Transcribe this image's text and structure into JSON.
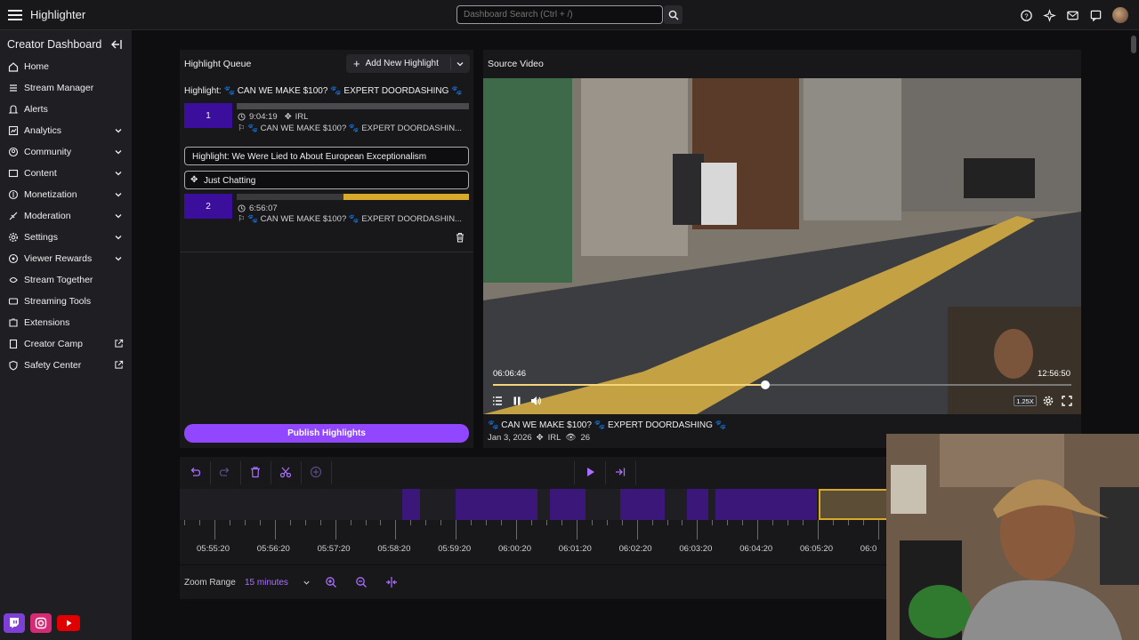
{
  "app": {
    "title": "Highlighter"
  },
  "search": {
    "placeholder": "Dashboard Search (Ctrl + /)"
  },
  "sidebar": {
    "title": "Creator Dashboard",
    "items": [
      {
        "label": "Home",
        "icon": "home-icon"
      },
      {
        "label": "Stream Manager",
        "icon": "stream-manager-icon"
      },
      {
        "label": "Alerts",
        "icon": "bell-icon"
      },
      {
        "label": "Analytics",
        "icon": "analytics-icon",
        "expandable": true
      },
      {
        "label": "Community",
        "icon": "community-icon",
        "expandable": true
      },
      {
        "label": "Content",
        "icon": "content-icon",
        "expandable": true
      },
      {
        "label": "Monetization",
        "icon": "monetization-icon",
        "expandable": true
      },
      {
        "label": "Moderation",
        "icon": "sword-icon",
        "expandable": true
      },
      {
        "label": "Settings",
        "icon": "gear-icon",
        "expandable": true
      },
      {
        "label": "Viewer Rewards",
        "icon": "rewards-icon",
        "expandable": true
      },
      {
        "label": "Stream Together",
        "icon": "stream-together-icon"
      },
      {
        "label": "Streaming Tools",
        "icon": "tools-icon"
      },
      {
        "label": "Extensions",
        "icon": "extensions-icon"
      },
      {
        "label": "Creator Camp",
        "icon": "book-icon",
        "external": true
      },
      {
        "label": "Safety Center",
        "icon": "shield-icon",
        "external": true
      }
    ]
  },
  "queue": {
    "title": "Highlight Queue",
    "add_label": "Add New Highlight",
    "highlight1": {
      "title": "Highlight: 🐾 CAN WE MAKE $100? 🐾 EXPERT DOORDASHING 🐾",
      "clip": {
        "number": "1",
        "time": "9:04:19",
        "category": "IRL",
        "source": "🐾 CAN WE MAKE $100? 🐾 EXPERT DOORDASHIN..."
      }
    },
    "highlight2": {
      "title_value": "Highlight: We Were Lied to About European Exceptionalism",
      "category_value": "Just Chatting",
      "clip": {
        "number": "2",
        "time": "6:56:07",
        "source": "🐾 CAN WE MAKE $100? 🐾 EXPERT DOORDASHIN..."
      }
    },
    "publish_label": "Publish Highlights"
  },
  "video": {
    "section_title": "Source Video",
    "current_time": "06:06:46",
    "total_time": "12:56:50",
    "progress": 0.47,
    "speed": "1.25X",
    "title": "🐾 CAN WE MAKE $100? 🐾 EXPERT DOORDASHING 🐾",
    "date": "Jan 3, 2026",
    "category": "IRL",
    "views": "26"
  },
  "timeline": {
    "labels": [
      "05:55:20",
      "05:56:20",
      "05:57:20",
      "05:58:20",
      "05:59:20",
      "06:00:20",
      "06:01:20",
      "06:02:20",
      "06:03:20",
      "06:04:20",
      "06:05:20",
      "06:0"
    ]
  },
  "zoom": {
    "label": "Zoom Range",
    "value": "15 minutes"
  },
  "colors": {
    "accent": "#9147ff",
    "clip_purple": "#3b0f9c",
    "clip_gold": "#d9a92a"
  }
}
